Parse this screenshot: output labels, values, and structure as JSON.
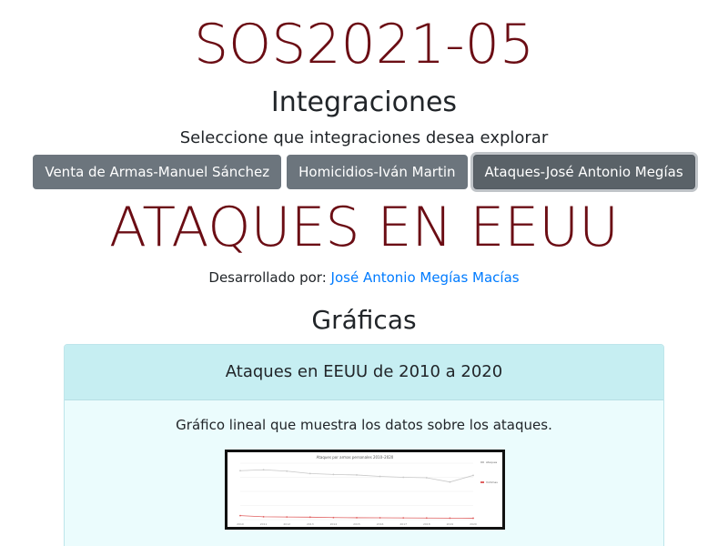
{
  "header": {
    "site_title": "SOS2021-05",
    "section_heading": "Integraciones",
    "section_sub": "Seleccione que integraciones desea explorar"
  },
  "integrations": {
    "buttons": [
      {
        "label": "Venta de Armas-Manuel Sánchez",
        "active": false
      },
      {
        "label": "Homicidios-Iván Martin",
        "active": false
      },
      {
        "label": "Ataques-José Antonio Megías",
        "active": true
      }
    ]
  },
  "main": {
    "title": "ATAQUES EN EEUU",
    "developed_by_label": "Desarrollado por:",
    "developer_name": "José Antonio Megías Macías",
    "graphs_heading": "Gráficas"
  },
  "card": {
    "header": "Ataques en EEUU de 2010 a 2020",
    "text": "Gráfico lineal que muestra los datos sobre los ataques."
  },
  "chart_data": {
    "type": "line",
    "title": "Ataques por armas personales 2010–2020",
    "x": [
      "2010",
      "2011",
      "2012",
      "2013",
      "2014",
      "2015",
      "2016",
      "2017",
      "2018",
      "2019",
      "2020"
    ],
    "series": [
      {
        "name": "Ataques",
        "values": [
          5200,
          5300,
          5150,
          4900,
          4800,
          4750,
          4600,
          4500,
          4450,
          4000,
          4700
        ],
        "color": "#c8c8c8"
      },
      {
        "name": "Victimas",
        "values": [
          420,
          300,
          280,
          260,
          220,
          200,
          190,
          180,
          170,
          160,
          150
        ],
        "color": "#e06060"
      }
    ],
    "ylim": [
      0,
      6000
    ],
    "legend": "right"
  },
  "colors": {
    "title": "#6b0d14",
    "button": "#6c757d",
    "link": "#007bff",
    "card_header": "#c6eef2",
    "card_body": "#ebfcfd"
  }
}
